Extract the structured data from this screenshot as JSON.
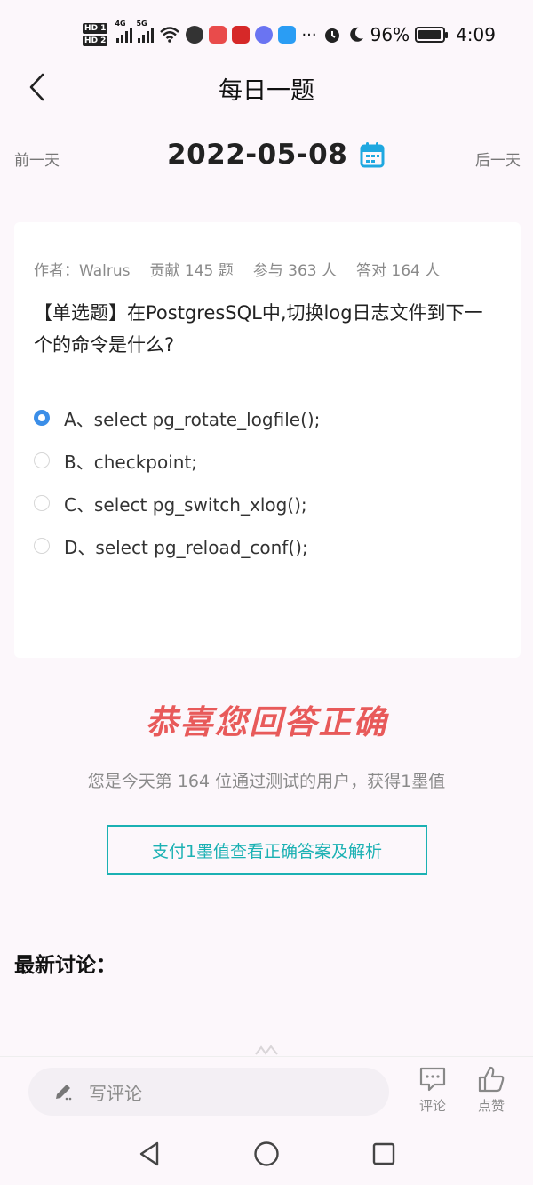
{
  "status_bar": {
    "signal_tag_1": "4G",
    "signal_tag_2": "5G",
    "battery_percent": "96%",
    "battery_level": 0.96,
    "time": "4:09",
    "icons": [
      "hd-icon",
      "signal-icon",
      "wifi-icon",
      "app-icons",
      "alarm-icon",
      "moon-icon",
      "battery-icon"
    ]
  },
  "header": {
    "title": "每日一题",
    "back_icon": "chevron-left-icon"
  },
  "date_nav": {
    "prev_label": "前一天",
    "date": "2022-05-08",
    "next_label": "后一天",
    "calendar_icon": "calendar-icon",
    "accent": "#1fa8e0"
  },
  "question": {
    "author": "作者：Walrus",
    "contributed": "贡献 145 题",
    "participants": "参与 363 人",
    "correct": "答对 164 人",
    "text": "【单选题】在PostgresSQL中,切换log日志文件到下一个的命令是什么?",
    "options": [
      {
        "label": "A、select pg_rotate_logfile();",
        "selected": true
      },
      {
        "label": "B、checkpoint;",
        "selected": false
      },
      {
        "label": "C、select pg_switch_xlog();",
        "selected": false
      },
      {
        "label": "D、select pg_reload_conf();",
        "selected": false
      }
    ]
  },
  "result": {
    "congrats": "恭喜您回答正确",
    "subline": "您是今天第 164 位通过测试的用户，获得1墨值",
    "pay_button": "支付1墨值查看正确答案及解析",
    "congrats_color": "#e85a5a",
    "button_color": "#1bb1b3"
  },
  "discussion": {
    "title": "最新讨论："
  },
  "bottom_bar": {
    "input_placeholder": "写评论",
    "comment_label": "评论",
    "like_label": "点赞"
  }
}
